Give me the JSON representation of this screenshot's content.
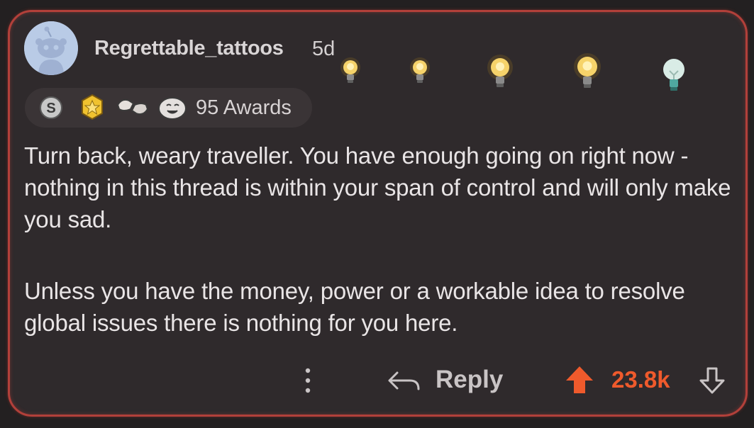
{
  "comment": {
    "username": "Regrettable_tattoos",
    "age": "5d",
    "awards_label": "95 Awards",
    "paragraphs": [
      "Turn back, weary traveller.  You have enough going on right now - nothing in this thread is within your span of control and will only make you sad.",
      "Unless you have the money, power or a workable idea to resolve global issues there is nothing for you here."
    ],
    "score": "23.8k"
  },
  "actions": {
    "reply_label": "Reply"
  },
  "icons": {
    "avatar": "snoo-avatar-icon",
    "bulbs": [
      "lightbulb-icon",
      "lightbulb-icon",
      "lightbulb-icon",
      "lightbulb-icon",
      "lightbulb-off-icon"
    ],
    "awards": [
      "silver-award-icon",
      "gold-award-icon",
      "fist-bump-award-icon",
      "laughing-face-award-icon"
    ],
    "more": "more-vertical-icon",
    "reply": "reply-arrow-icon",
    "upvote": "upvote-arrow-icon",
    "downvote": "downvote-arrow-icon"
  },
  "colors": {
    "background": "#232021",
    "card": "#2f2a2c",
    "border": "#b2403a",
    "upvote": "#ef5a2c",
    "text": "#e9e5e6"
  }
}
